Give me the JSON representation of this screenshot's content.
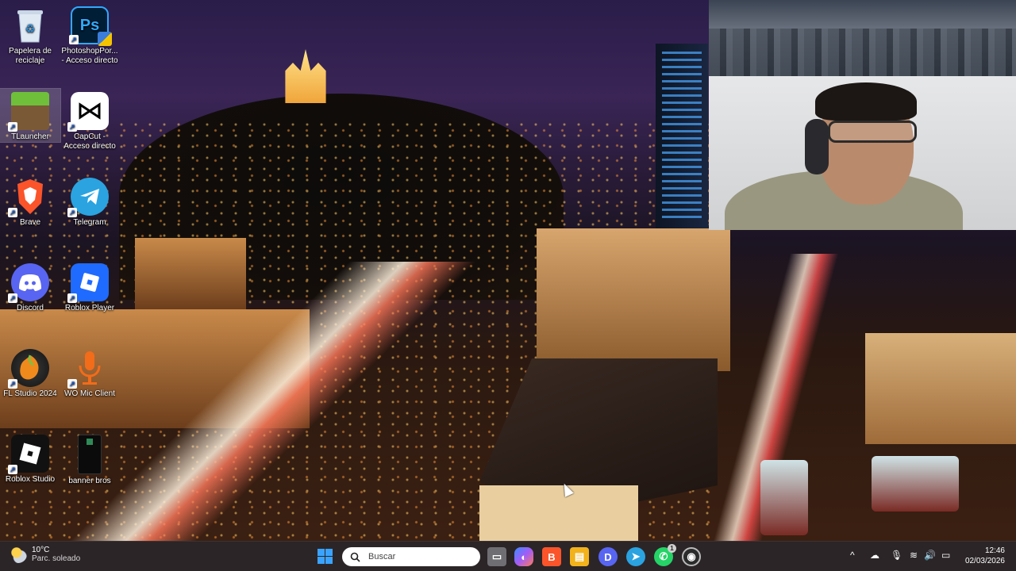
{
  "desktop": {
    "icons": [
      {
        "label": "Papelera de reciclaje",
        "icon": "recycle-bin-icon",
        "color": "#d9e7f5"
      },
      {
        "label": "PhotoshopPor... - Acceso directo",
        "icon": "photoshop-icon",
        "color": "#001e36",
        "glyph": "Ps"
      },
      {
        "label": "TLauncher",
        "icon": "tlauncher-icon",
        "color": "#5a8c2c"
      },
      {
        "label": "CapCut - Acceso directo",
        "icon": "capcut-icon",
        "color": "#ffffff"
      },
      {
        "label": "Brave",
        "icon": "brave-icon",
        "color": "#fb542b"
      },
      {
        "label": "Telegram",
        "icon": "telegram-icon",
        "color": "#2aa3e0"
      },
      {
        "label": "Discord",
        "icon": "discord-icon",
        "color": "#5865f2"
      },
      {
        "label": "Roblox Player",
        "icon": "roblox-player-icon",
        "color": "#1f6bff"
      },
      {
        "label": "FL Studio 2024",
        "icon": "fl-studio-icon",
        "color": "#f08a1c"
      },
      {
        "label": "WO Mic Client",
        "icon": "microphone-icon",
        "color": "#f26c1a"
      },
      {
        "label": "Roblox Studio",
        "icon": "roblox-studio-icon",
        "color": "#1a1a1a"
      },
      {
        "label": "banner bros",
        "icon": "banner-bros-icon",
        "color": "#0b0b0b"
      }
    ]
  },
  "webcam": {
    "label": "webcam overlay"
  },
  "taskbar": {
    "weather": {
      "temp": "10°C",
      "condition": "Parc. soleado",
      "icon": "partly-sunny-icon"
    },
    "search": {
      "placeholder": "Buscar"
    },
    "apps": [
      {
        "name": "task-view-icon",
        "glyph": "▭",
        "color": "#6f6f73"
      },
      {
        "name": "copilot-icon",
        "glyph": "◐",
        "color": "#8a5cf6"
      },
      {
        "name": "brave-icon",
        "glyph": "B",
        "color": "#fb542b"
      },
      {
        "name": "file-explorer-icon",
        "glyph": "▤",
        "color": "#f2b21b"
      },
      {
        "name": "discord-icon",
        "glyph": "D",
        "color": "#5865f2"
      },
      {
        "name": "telegram-icon",
        "glyph": "➤",
        "color": "#2aa3e0"
      },
      {
        "name": "whatsapp-icon",
        "glyph": "✆",
        "color": "#25d366",
        "badge": "1"
      },
      {
        "name": "obs-icon",
        "glyph": "◉",
        "color": "#2b2b2b"
      }
    ],
    "tray": {
      "chevron": "^",
      "time": "12:46",
      "date": "02/03/2026"
    }
  }
}
